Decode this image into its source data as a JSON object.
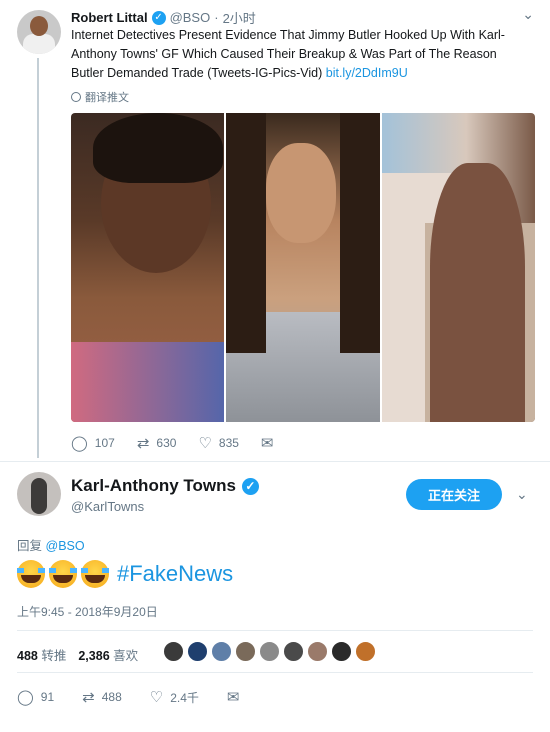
{
  "quoted_tweet": {
    "author_name": "Robert Littal",
    "author_handle": "@BSO",
    "separator": "·",
    "time": "2小时",
    "text": "Internet Detectives Present Evidence That Jimmy Butler Hooked Up With Karl-Anthony Towns' GF Which Caused Their Breakup & Was Part of The Reason Butler Demanded Trade (Tweets-IG-Pics-Vid)",
    "link": "bit.ly/2DdIm9U",
    "translate_label": "翻译推文",
    "replies": "107",
    "retweets": "630",
    "likes": "835"
  },
  "main_tweet": {
    "author_name": "Karl-Anthony Towns",
    "author_handle": "@KarlTowns",
    "follow_button": "正在关注",
    "reply_prefix": "回复",
    "reply_handle": "@BSO",
    "hashtag": "#FakeNews",
    "timestamp": "上午9:45 - 2018年9月20日",
    "retweets_count": "488",
    "retweets_label": "转推",
    "likes_count": "2,386",
    "likes_label": "喜欢",
    "replies": "91",
    "retweets": "488",
    "likes": "2.4千"
  },
  "colors": {
    "accent": "#1da1f2",
    "link": "#1b95e0",
    "muted": "#657786"
  },
  "icons": {
    "reply": "reply-icon",
    "retweet": "retweet-icon",
    "like": "heart-icon",
    "message": "envelope-icon"
  }
}
